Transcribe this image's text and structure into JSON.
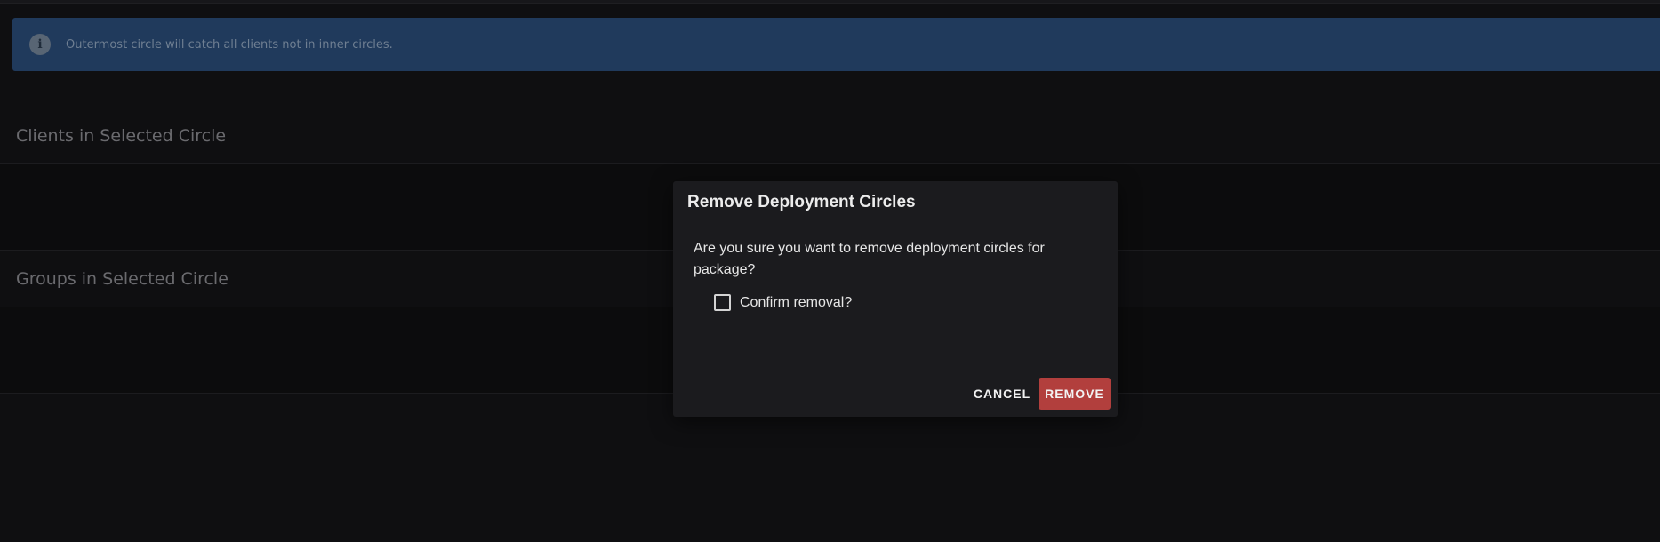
{
  "info_banner": {
    "icon": "info-icon",
    "icon_glyph": "i",
    "text": "Outermost circle will catch all clients not in inner circles."
  },
  "sections": {
    "clients": {
      "title": "Clients in Selected Circle"
    },
    "groups": {
      "title": "Groups in Selected Circle"
    }
  },
  "dialog": {
    "title": "Remove Deployment Circles",
    "message": "Are you sure you want to remove deployment circles for package?",
    "confirm_label": "Confirm removal?",
    "confirm_checked": false,
    "cancel_label": "CANCEL",
    "remove_label": "REMOVE"
  },
  "colors": {
    "banner_bg": "#203a5c",
    "remove_button": "#b23f3d",
    "dialog_bg": "#1b1b1e",
    "page_bg": "#0f0f11"
  }
}
